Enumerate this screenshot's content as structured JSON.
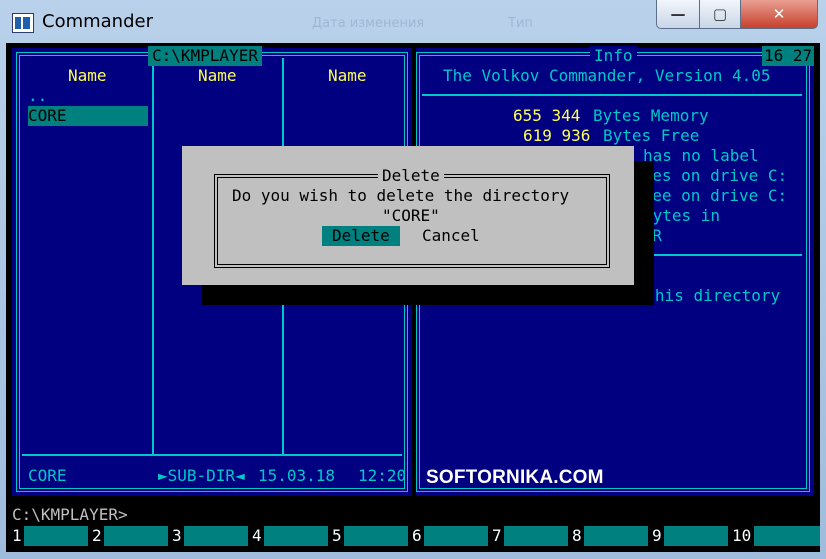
{
  "window": {
    "title": "Commander",
    "ghost_1": "Дата изменения",
    "ghost_2": "Тип"
  },
  "controls": {
    "minimize": "—",
    "maximize": "▢",
    "close": "✕"
  },
  "left_panel": {
    "path": "C:\\KMPLAYER",
    "columns": [
      "Name",
      "Name",
      "Name"
    ],
    "files": [
      "..",
      "CORE"
    ],
    "status_name": "CORE",
    "status_type": "►SUB-DIR◄",
    "status_date": "15.03.18",
    "status_time": "12:20"
  },
  "right_panel": {
    "title": "Info",
    "clock": "16 27",
    "version": "The Volkov Commander, Version 4.05",
    "mem_value": "655 344",
    "mem_label": "Bytes Memory",
    "free_value": "619 936",
    "free_label": "Bytes Free",
    "line_label": "has no label",
    "line_drive1": "ytes on drive C:",
    "line_drive2": "free on drive C:",
    "line_bytes_in": "bytes in",
    "line_yer": "YER",
    "dirinfo": "No `dirinfo' file in this directory"
  },
  "dialog": {
    "title": "Delete",
    "message": "Do you wish to delete the directory",
    "target": "\"CORE\"",
    "ok_label": "Delete",
    "cancel_label": "Cancel"
  },
  "watermark": "SOFTORNIKA.COM",
  "prompt": "C:\\KMPLAYER>",
  "fkeys": [
    "1",
    "2",
    "3",
    "4",
    "5",
    "6",
    "7",
    "8",
    "9",
    "10"
  ],
  "colors": {
    "panel_bg": "#000080",
    "border": "#00c8c8",
    "highlight": "#00807f",
    "dialog_bg": "#c0c0c0",
    "yellow": "#ffff54"
  }
}
